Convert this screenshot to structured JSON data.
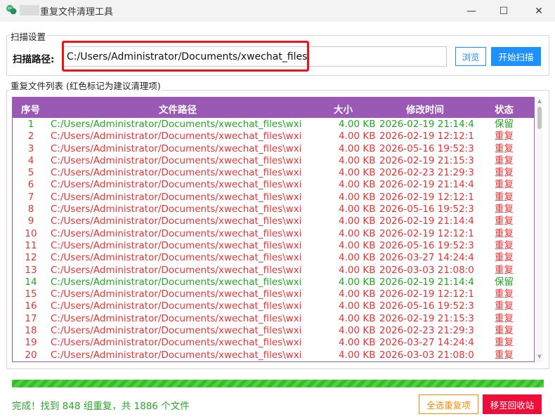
{
  "window": {
    "title": "重复文件清理工具",
    "minimize_glyph": "—",
    "maximize_glyph": "☐",
    "close_glyph": "✕"
  },
  "scan_settings": {
    "group_label": "扫描设置",
    "path_label": "扫描路径:",
    "path_value": "C:/Users/Administrator/Documents/xwechat_files",
    "browse_label": "浏览",
    "start_label": "开始扫描",
    "highlight_color": "#e8141b"
  },
  "file_list": {
    "group_label": "重复文件列表 (红色标记为建议清理项)",
    "columns": [
      "序号",
      "文件路径",
      "大小",
      "修改时间",
      "状态"
    ],
    "header_color": "#9b59b6",
    "keep_color": "#22a622",
    "dup_color": "#e63434",
    "rows": [
      {
        "idx": "1",
        "path": "C:/Users/Administrator/Documents/xwechat_files\\wxi",
        "size": "4.00 KB",
        "time": "2026-02-19 21:14:4",
        "status": "保留",
        "keep": true
      },
      {
        "idx": "2",
        "path": "C:/Users/Administrator/Documents/xwechat_files\\wxi",
        "size": "4.00 KB",
        "time": "2026-02-19 12:12:1",
        "status": "重复",
        "keep": false
      },
      {
        "idx": "3",
        "path": "C:/Users/Administrator/Documents/xwechat_files\\wxi",
        "size": "4.00 KB",
        "time": "2026-05-16 19:52:3",
        "status": "重复",
        "keep": false
      },
      {
        "idx": "4",
        "path": "C:/Users/Administrator/Documents/xwechat_files\\wxi",
        "size": "4.00 KB",
        "time": "2026-02-19 21:15:3",
        "status": "重复",
        "keep": false
      },
      {
        "idx": "5",
        "path": "C:/Users/Administrator/Documents/xwechat_files\\wxi",
        "size": "4.00 KB",
        "time": "2026-02-23 21:29:3",
        "status": "重复",
        "keep": false
      },
      {
        "idx": "6",
        "path": "C:/Users/Administrator/Documents/xwechat_files\\wxi",
        "size": "4.00 KB",
        "time": "2026-02-19 21:14:4",
        "status": "重复",
        "keep": false
      },
      {
        "idx": "7",
        "path": "C:/Users/Administrator/Documents/xwechat_files\\wxi",
        "size": "4.00 KB",
        "time": "2026-02-19 12:12:1",
        "status": "重复",
        "keep": false
      },
      {
        "idx": "8",
        "path": "C:/Users/Administrator/Documents/xwechat_files\\wxi",
        "size": "4.00 KB",
        "time": "2026-05-16 19:52:3",
        "status": "重复",
        "keep": false
      },
      {
        "idx": "9",
        "path": "C:/Users/Administrator/Documents/xwechat_files\\wxi",
        "size": "4.00 KB",
        "time": "2026-02-19 21:14:4",
        "status": "重复",
        "keep": false
      },
      {
        "idx": "10",
        "path": "C:/Users/Administrator/Documents/xwechat_files\\wxi",
        "size": "4.00 KB",
        "time": "2026-02-19 12:12:1",
        "status": "重复",
        "keep": false
      },
      {
        "idx": "11",
        "path": "C:/Users/Administrator/Documents/xwechat_files\\wxi",
        "size": "4.00 KB",
        "time": "2026-05-16 19:52:3",
        "status": "重复",
        "keep": false
      },
      {
        "idx": "12",
        "path": "C:/Users/Administrator/Documents/xwechat_files\\wxi",
        "size": "4.00 KB",
        "time": "2026-03-27 14:24:4",
        "status": "重复",
        "keep": false
      },
      {
        "idx": "13",
        "path": "C:/Users/Administrator/Documents/xwechat_files\\wxi",
        "size": "4.00 KB",
        "time": "2026-03-03 21:08:0",
        "status": "重复",
        "keep": false
      },
      {
        "idx": "14",
        "path": "C:/Users/Administrator/Documents/xwechat_files\\wxi",
        "size": "4.00 KB",
        "time": "2026-02-19 21:14:4",
        "status": "保留",
        "keep": true
      },
      {
        "idx": "15",
        "path": "C:/Users/Administrator/Documents/xwechat_files\\wxi",
        "size": "4.00 KB",
        "time": "2026-02-19 12:12:1",
        "status": "重复",
        "keep": false
      },
      {
        "idx": "16",
        "path": "C:/Users/Administrator/Documents/xwechat_files\\wxi",
        "size": "4.00 KB",
        "time": "2026-05-16 19:52:3",
        "status": "重复",
        "keep": false
      },
      {
        "idx": "17",
        "path": "C:/Users/Administrator/Documents/xwechat_files\\wxi",
        "size": "4.00 KB",
        "time": "2026-02-19 21:15:3",
        "status": "重复",
        "keep": false
      },
      {
        "idx": "18",
        "path": "C:/Users/Administrator/Documents/xwechat_files\\wxi",
        "size": "4.00 KB",
        "time": "2026-02-23 21:29:3",
        "status": "重复",
        "keep": false
      },
      {
        "idx": "19",
        "path": "C:/Users/Administrator/Documents/xwechat_files\\wxi",
        "size": "4.00 KB",
        "time": "2026-03-27 14:24:4",
        "status": "重复",
        "keep": false
      },
      {
        "idx": "20",
        "path": "C:/Users/Administrator/Documents/xwechat_files\\wxi",
        "size": "4.00 KB",
        "time": "2026-03-03 21:08:0",
        "status": "重复",
        "keep": false
      }
    ]
  },
  "progress": {
    "percent": 100,
    "color": "#31c220"
  },
  "footer": {
    "status_text": "完成！找到 848 组重复，共 1886 个文件",
    "select_dup_label": "全选重复项",
    "recycle_label": "移至回收站"
  }
}
